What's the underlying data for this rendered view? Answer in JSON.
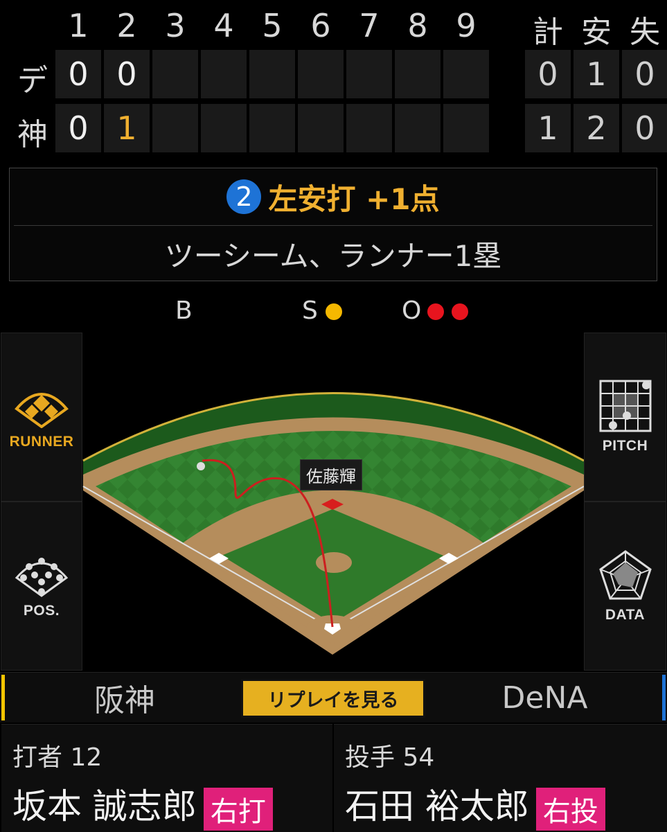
{
  "scoreboard": {
    "innings": [
      "1",
      "2",
      "3",
      "4",
      "5",
      "6",
      "7",
      "8",
      "9"
    ],
    "totals_headers": [
      "計",
      "安",
      "失"
    ],
    "away": {
      "abbr": "デ",
      "scores": [
        "0",
        "0",
        "",
        "",
        "",
        "",
        "",
        "",
        ""
      ],
      "totals": [
        "0",
        "1",
        "0"
      ]
    },
    "home": {
      "abbr": "神",
      "scores": [
        "0",
        "1",
        "",
        "",
        "",
        "",
        "",
        "",
        ""
      ],
      "totals": [
        "1",
        "2",
        "0"
      ]
    }
  },
  "play": {
    "batter_order": "2",
    "result": "左安打 +1点",
    "description": "ツーシーム、ランナー1塁"
  },
  "count": {
    "balls_label": "B",
    "balls": 0,
    "strikes_label": "S",
    "strikes": 1,
    "outs_label": "O",
    "outs": 2,
    "colors": {
      "strike": "#f5b800",
      "out": "#e8141e"
    }
  },
  "field": {
    "fielder_label": "佐藤輝",
    "colors": {
      "grass": "#2f7a2a",
      "dirt": "#b58d5c",
      "hit_path": "#cc1f1f"
    }
  },
  "side_buttons": {
    "runner": "RUNNER",
    "pitch": "PITCH",
    "pos": "POS.",
    "data": "DATA",
    "runner_color": "#e8a820"
  },
  "teams": {
    "left": "阪神",
    "right": "DeNA",
    "left_accent": "#f5c400",
    "right_accent": "#1e73d6"
  },
  "replay_button": "リプレイを見る",
  "batter": {
    "role": "打者 12",
    "name": "坂本 誠志郎",
    "hand": "右打"
  },
  "pitcher": {
    "role": "投手 54",
    "name": "石田 裕太郎",
    "hand": "右投"
  }
}
